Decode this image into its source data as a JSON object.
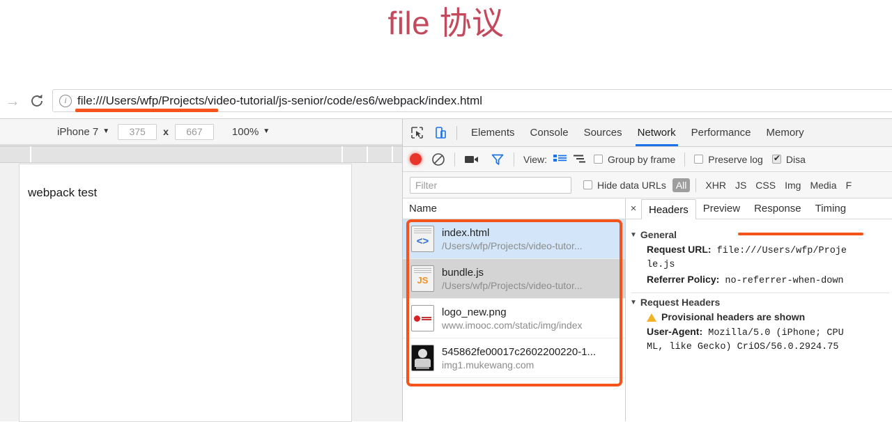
{
  "slide": {
    "title": "file 协议"
  },
  "browser": {
    "nav": {
      "forward_icon": "arrow-right-icon",
      "reload_icon": "reload-icon"
    },
    "omnibox": {
      "info_icon": "info-icon",
      "url": "file:///Users/wfp/Projects/video-tutorial/js-senior/code/es6/webpack/index.html",
      "highlight_color": "#f4531b"
    }
  },
  "device_toolbar": {
    "device": "iPhone 7",
    "caret": "▼",
    "width": "375",
    "height": "667",
    "multiply": "x",
    "zoom": "100%"
  },
  "page": {
    "heading": "webpack test"
  },
  "devtools": {
    "tools": {
      "inspect_icon": "inspect-cursor-icon",
      "device_icon": "device-toggle-icon"
    },
    "tabs": [
      {
        "label": "Elements",
        "active": false
      },
      {
        "label": "Console",
        "active": false
      },
      {
        "label": "Sources",
        "active": false
      },
      {
        "label": "Network",
        "active": true
      },
      {
        "label": "Performance",
        "active": false
      },
      {
        "label": "Memory",
        "active": false
      }
    ],
    "network_bar": {
      "record_icon": "record-circle-icon",
      "clear_icon": "clear-circle-slash-icon",
      "camera_icon": "camera-icon",
      "filter_icon": "funnel-icon",
      "view_label": "View:",
      "view_list_icon": "list-view-icon",
      "view_waterfall_icon": "waterfall-view-icon",
      "group_by_frame": {
        "label": "Group by frame",
        "checked": false
      },
      "preserve_log": {
        "label": "Preserve log",
        "checked": false
      },
      "disable_cache": {
        "label": "Disa",
        "checked": true
      }
    },
    "filter_bar": {
      "filter_placeholder": "Filter",
      "hide_data_urls": {
        "label": "Hide data URLs",
        "checked": false
      },
      "types": [
        "All",
        "XHR",
        "JS",
        "CSS",
        "Img",
        "Media",
        "F"
      ],
      "selected_type": "All"
    },
    "network_list": {
      "column_header": "Name",
      "rows": [
        {
          "name": "index.html",
          "sub": "/Users/wfp/Projects/video-tutor...",
          "icon": "html-document-icon",
          "badge": "<>",
          "state": "selected"
        },
        {
          "name": "bundle.js",
          "sub": "/Users/wfp/Projects/video-tutor...",
          "icon": "js-document-icon",
          "badge": "JS",
          "state": "hover"
        },
        {
          "name": "logo_new.png",
          "sub": "www.imooc.com/static/img/index",
          "icon": "image-thumbnail-icon",
          "badge": "",
          "state": "normal"
        },
        {
          "name": "545862fe00017c2602200220-1...",
          "sub": "img1.mukewang.com",
          "icon": "image-thumbnail-icon",
          "badge": "",
          "state": "normal"
        }
      ],
      "annotation_color": "#f4531b"
    },
    "detail": {
      "close_icon": "close-icon",
      "tabs": [
        {
          "label": "Headers",
          "active": true
        },
        {
          "label": "Preview",
          "active": false
        },
        {
          "label": "Response",
          "active": false
        },
        {
          "label": "Timing",
          "active": false
        }
      ],
      "general": {
        "title": "General",
        "request_url_label": "Request URL:",
        "request_url_value": "file:///Users/wfp/Proje",
        "request_url_wrap": "le.js",
        "referrer_policy_label": "Referrer Policy:",
        "referrer_policy_value": "no-referrer-when-down"
      },
      "request_headers": {
        "title": "Request Headers",
        "warning_icon": "warning-triangle-icon",
        "warning": "Provisional headers are shown",
        "user_agent_label": "User-Agent:",
        "user_agent_value": "Mozilla/5.0 (iPhone; CPU",
        "user_agent_wrap": "ML, like Gecko) CriOS/56.0.2924.75 "
      }
    }
  }
}
